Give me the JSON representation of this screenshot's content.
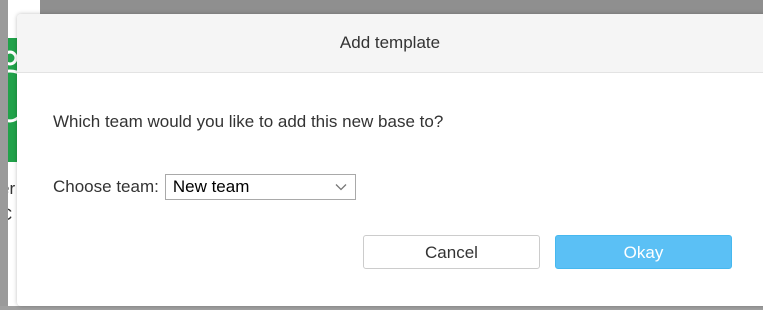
{
  "background": {
    "partial_text_line1": "er",
    "partial_text_line2": "C"
  },
  "dialog": {
    "title": "Add template",
    "question": "Which team would you like to add this new base to?",
    "team_label": "Choose team:",
    "team_select_value": "New team",
    "cancel_label": "Cancel",
    "okay_label": "Okay"
  },
  "colors": {
    "primary_button": "#5bc0f5",
    "header_background": "#f5f5f5",
    "thumbnail_green": "#21a24a"
  },
  "icons": {
    "select_arrow": "chevron-down-icon"
  }
}
